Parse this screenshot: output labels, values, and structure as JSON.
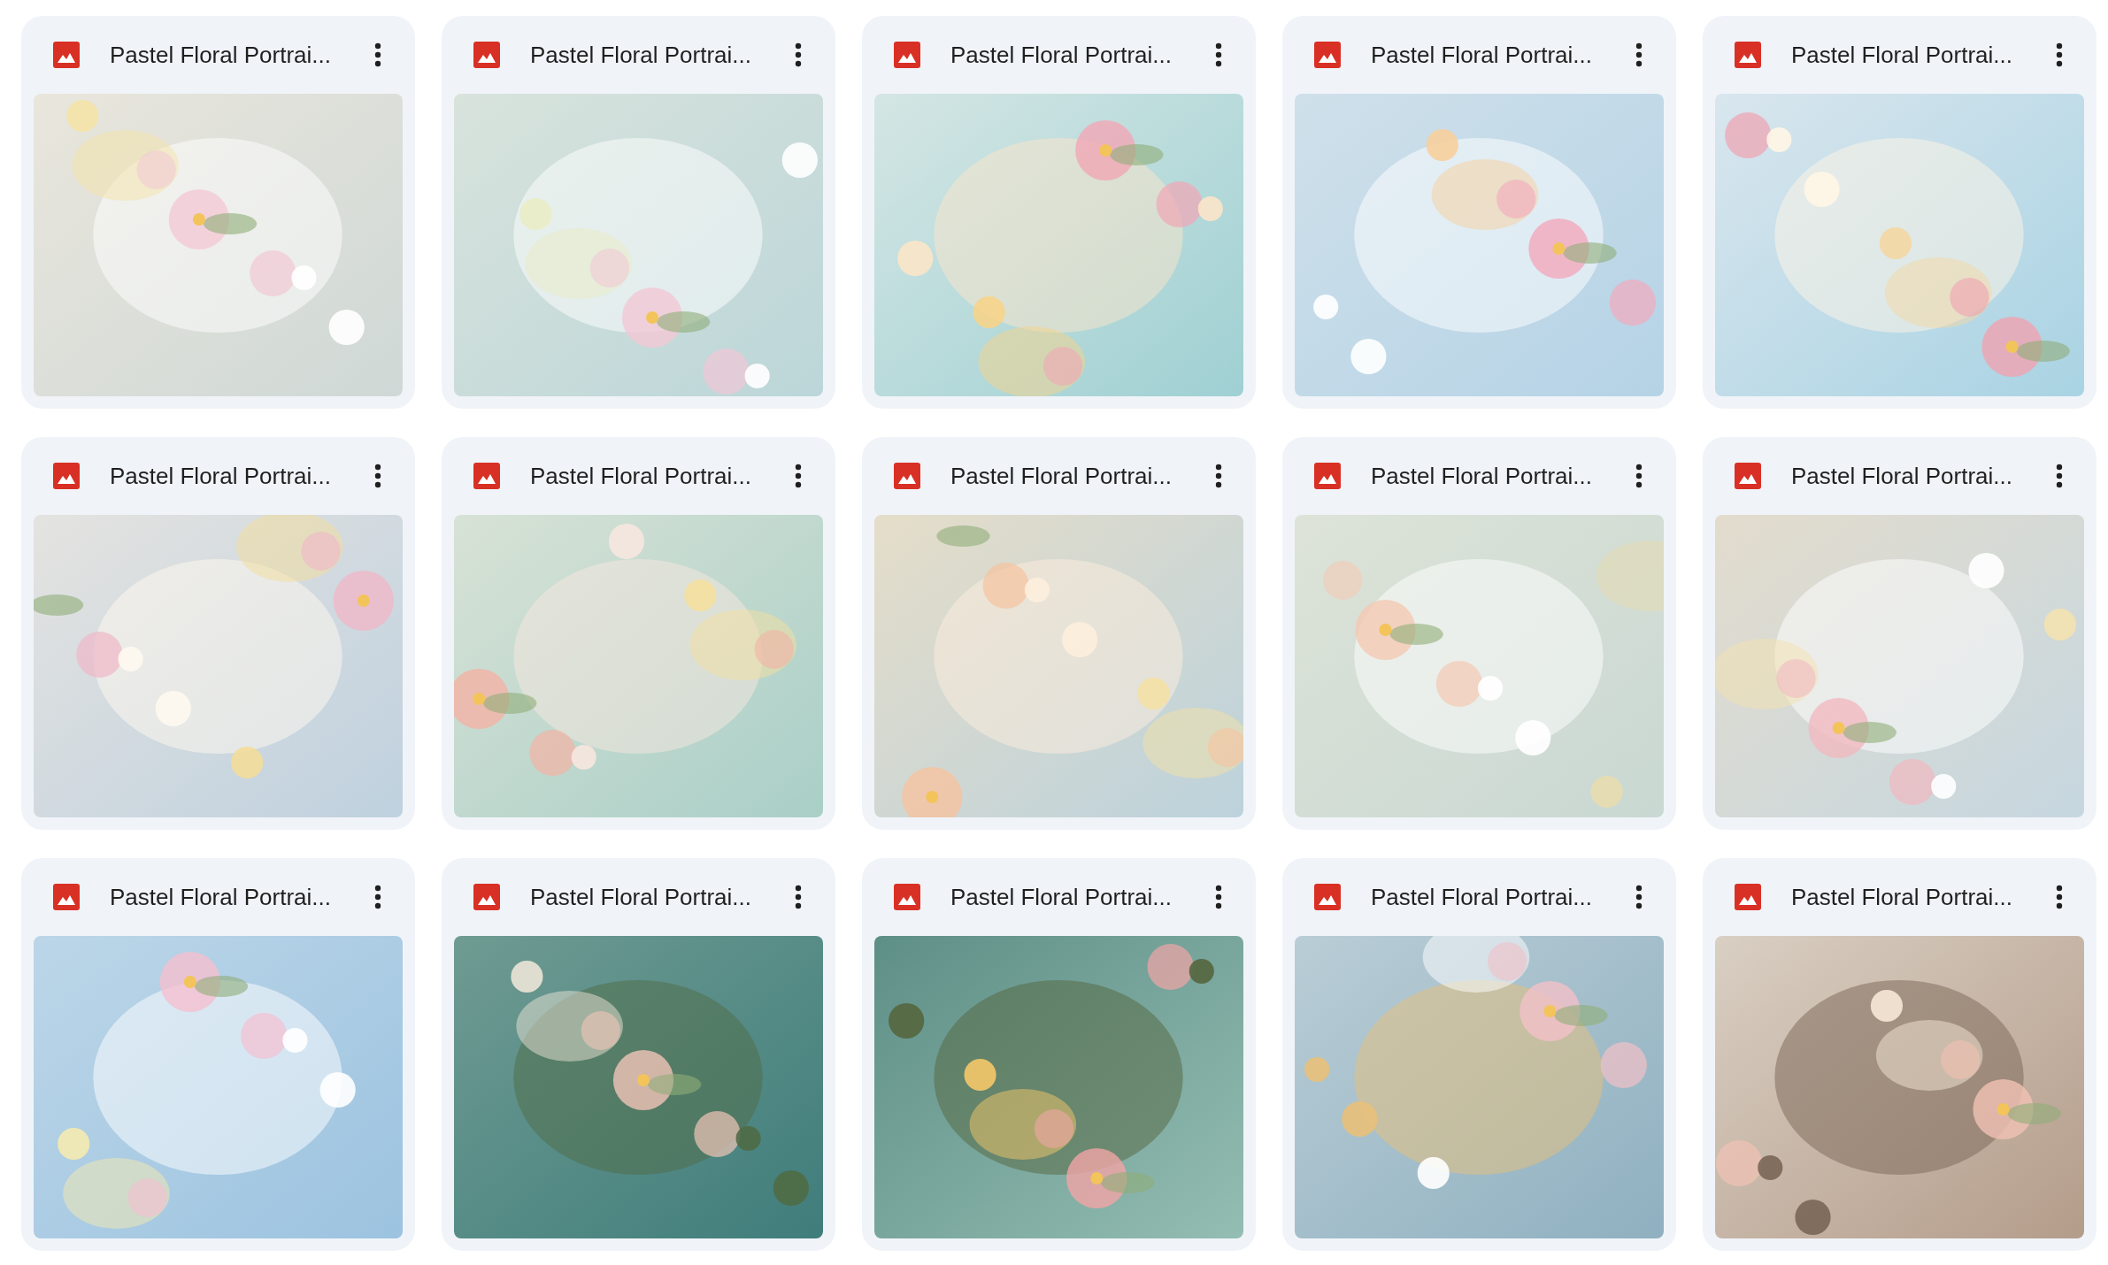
{
  "files": [
    {
      "title": "Pastel Floral Portrai...",
      "kind": "picture"
    },
    {
      "title": "Pastel Floral Portrai...",
      "kind": "picture"
    },
    {
      "title": "Pastel Floral Portrai...",
      "kind": "picture"
    },
    {
      "title": "Pastel Floral Portrai...",
      "kind": "picture"
    },
    {
      "title": "Pastel Floral Portrai...",
      "kind": "picture"
    },
    {
      "title": "Pastel Floral Portrai...",
      "kind": "picture"
    },
    {
      "title": "Pastel Floral Portrai...",
      "kind": "picture"
    },
    {
      "title": "Pastel Floral Portrai...",
      "kind": "picture"
    },
    {
      "title": "Pastel Floral Portrai...",
      "kind": "picture"
    },
    {
      "title": "Pastel Floral Portrai...",
      "kind": "picture"
    },
    {
      "title": "Pastel Floral Portrai...",
      "kind": "picture"
    },
    {
      "title": "Pastel Floral Portrai...",
      "kind": "picture"
    },
    {
      "title": "Pastel Floral Portrai...",
      "kind": "picture"
    },
    {
      "title": "Pastel Floral Portrai...",
      "kind": "picture"
    },
    {
      "title": "Pastel Floral Portrai...",
      "kind": "picture"
    }
  ]
}
